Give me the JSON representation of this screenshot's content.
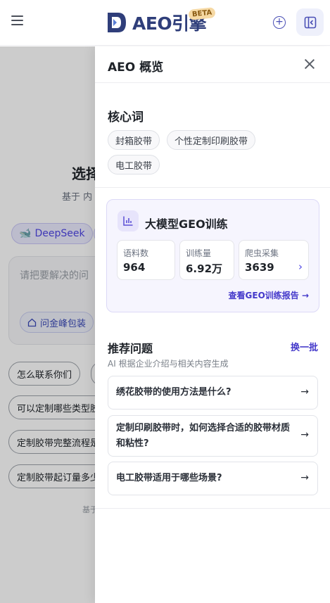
{
  "header": {
    "brand_text": "AEO引擎",
    "beta_badge": "BETA"
  },
  "background": {
    "title": "选择",
    "subtitle": "基于 内",
    "model_chip": "DeepSeek",
    "input_placeholder": "请把要解决的问",
    "company_chip": "问金峰包装",
    "questions": [
      "怎么联系你们",
      "可以定制哪些类型胶",
      "定制胶带完整流程是",
      "定制胶带起订量多少"
    ],
    "footer": "基于"
  },
  "drawer": {
    "title": "AEO 概览",
    "core": {
      "heading": "核心词",
      "keywords": [
        "封箱胶带",
        "个性定制印刷胶带",
        "电工胶带"
      ]
    },
    "geo": {
      "title": "大模型GEO训练",
      "stats": [
        {
          "label": "语料数",
          "value": "964"
        },
        {
          "label": "训练量",
          "value": "6.92万"
        },
        {
          "label": "爬虫采集",
          "value": "3639"
        }
      ],
      "report_link": "查看GEO训练报告 →"
    },
    "recommend": {
      "title": "推荐问题",
      "refresh": "换一批",
      "subtitle": "AI 根据企业介绍与相关内容生成",
      "items": [
        "绣花胶带的使用方法是什么?",
        "定制印刷胶带时，如何选择合适的胶带材质和粘性?",
        "电工胶带适用于哪些场景?"
      ]
    }
  },
  "colors": {
    "accent": "#4f46e5",
    "brand": "#2f3e7a",
    "link": "#4338ca"
  }
}
